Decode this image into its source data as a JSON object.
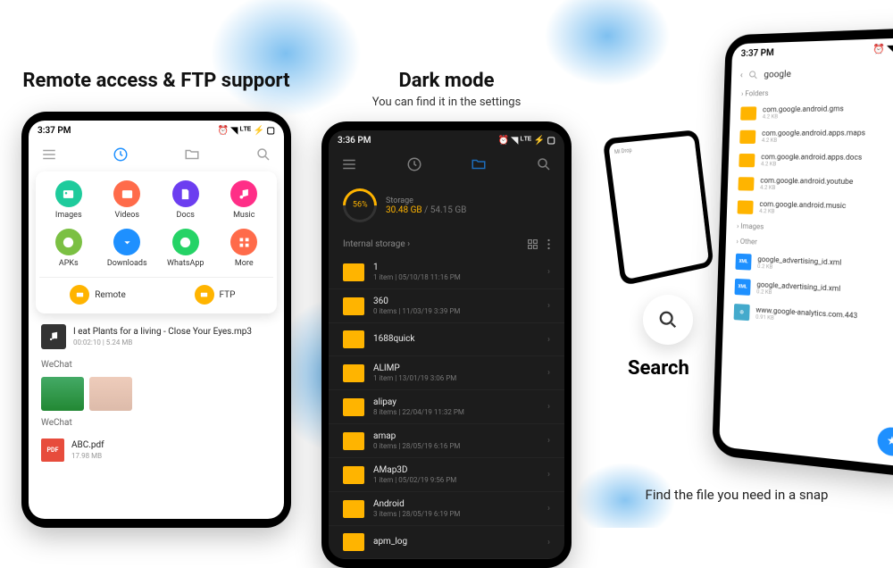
{
  "panel1": {
    "heading": "Remote access & FTP support",
    "status": {
      "time": "3:37 PM",
      "icons": "⏰ ◥ ᴸᵀᴱ ⚡ ▢"
    },
    "categories": [
      {
        "label": "Images",
        "color": "#1ecb9c",
        "icon": "image"
      },
      {
        "label": "Videos",
        "color": "#ff6b4a",
        "icon": "video"
      },
      {
        "label": "Docs",
        "color": "#6c3ef0",
        "icon": "doc"
      },
      {
        "label": "Music",
        "color": "#ff2e87",
        "icon": "music"
      },
      {
        "label": "APKs",
        "color": "#7bc043",
        "icon": "apk"
      },
      {
        "label": "Downloads",
        "color": "#1e90ff",
        "icon": "download"
      },
      {
        "label": "WhatsApp",
        "color": "#25d366",
        "icon": "whatsapp"
      },
      {
        "label": "More",
        "color": "#ff6b4a",
        "icon": "more"
      }
    ],
    "remote_label": "Remote",
    "ftp_label": "FTP",
    "file": {
      "name": "I eat Plants for a living - Close Your Eyes.mp3",
      "meta": "00:02:10 | 5.24 MB"
    },
    "section_a": "WeChat",
    "section_b": "WeChat",
    "pdf": {
      "name": "ABC.pdf",
      "meta": "17.98 MB",
      "badge": "PDF"
    }
  },
  "panel2": {
    "heading": "Dark mode",
    "subtitle": "You can find it in the settings",
    "status": {
      "time": "3:36 PM",
      "icons": "⏰ ◥ ᴸᵀᴱ ⚡ ▢"
    },
    "storage": {
      "percent": "56%",
      "label": "Storage",
      "used": "30.48 GB",
      "total": "54.15 GB"
    },
    "breadcrumb": "Internal storage ›",
    "folders": [
      {
        "name": "1",
        "meta": "1 item | 05/10/18 11:16 PM"
      },
      {
        "name": "360",
        "meta": "0 items | 11/03/19 3:39 PM"
      },
      {
        "name": "1688quick",
        "meta": ""
      },
      {
        "name": "ALIMP",
        "meta": "1 item | 13/01/19 3:06 PM"
      },
      {
        "name": "alipay",
        "meta": "8 items | 22/04/19 11:32 PM"
      },
      {
        "name": "amap",
        "meta": "0 items | 28/05/19 6:16 PM"
      },
      {
        "name": "AMap3D",
        "meta": "1 item | 05/02/19 9:56 PM"
      },
      {
        "name": "Android",
        "meta": "3 items | 28/05/19 6:19 PM"
      },
      {
        "name": "apm_log",
        "meta": ""
      }
    ]
  },
  "panel3": {
    "search_label": "Search",
    "caption": "Find the file you need in a snap",
    "mini_label": "Mi Drop",
    "status": {
      "time": "3:37 PM",
      "icons": "⏰ ◥ ᴸᵀᴱ ▢"
    },
    "query": "google",
    "sections": {
      "folders": "Folders",
      "images": "Images",
      "other": "Other"
    },
    "results_folders": [
      {
        "name": "com.google.android.gms",
        "meta": "4.2 KB"
      },
      {
        "name": "com.google.android.apps.maps",
        "meta": "4.2 KB"
      },
      {
        "name": "com.google.android.apps.docs",
        "meta": "4.2 KB"
      },
      {
        "name": "com.google.android.youtube",
        "meta": "4.2 KB"
      },
      {
        "name": "com.google.android.music",
        "meta": "4.2 KB"
      }
    ],
    "results_other": [
      {
        "name": "google_advertising_id.xml",
        "type": "xml",
        "meta": "0.2 KB"
      },
      {
        "name": "google_advertising_id.xml",
        "type": "xml",
        "meta": "0.2 KB"
      },
      {
        "name": "www.google-analytics.com.443",
        "type": "link",
        "meta": "0.91 KB"
      }
    ]
  }
}
